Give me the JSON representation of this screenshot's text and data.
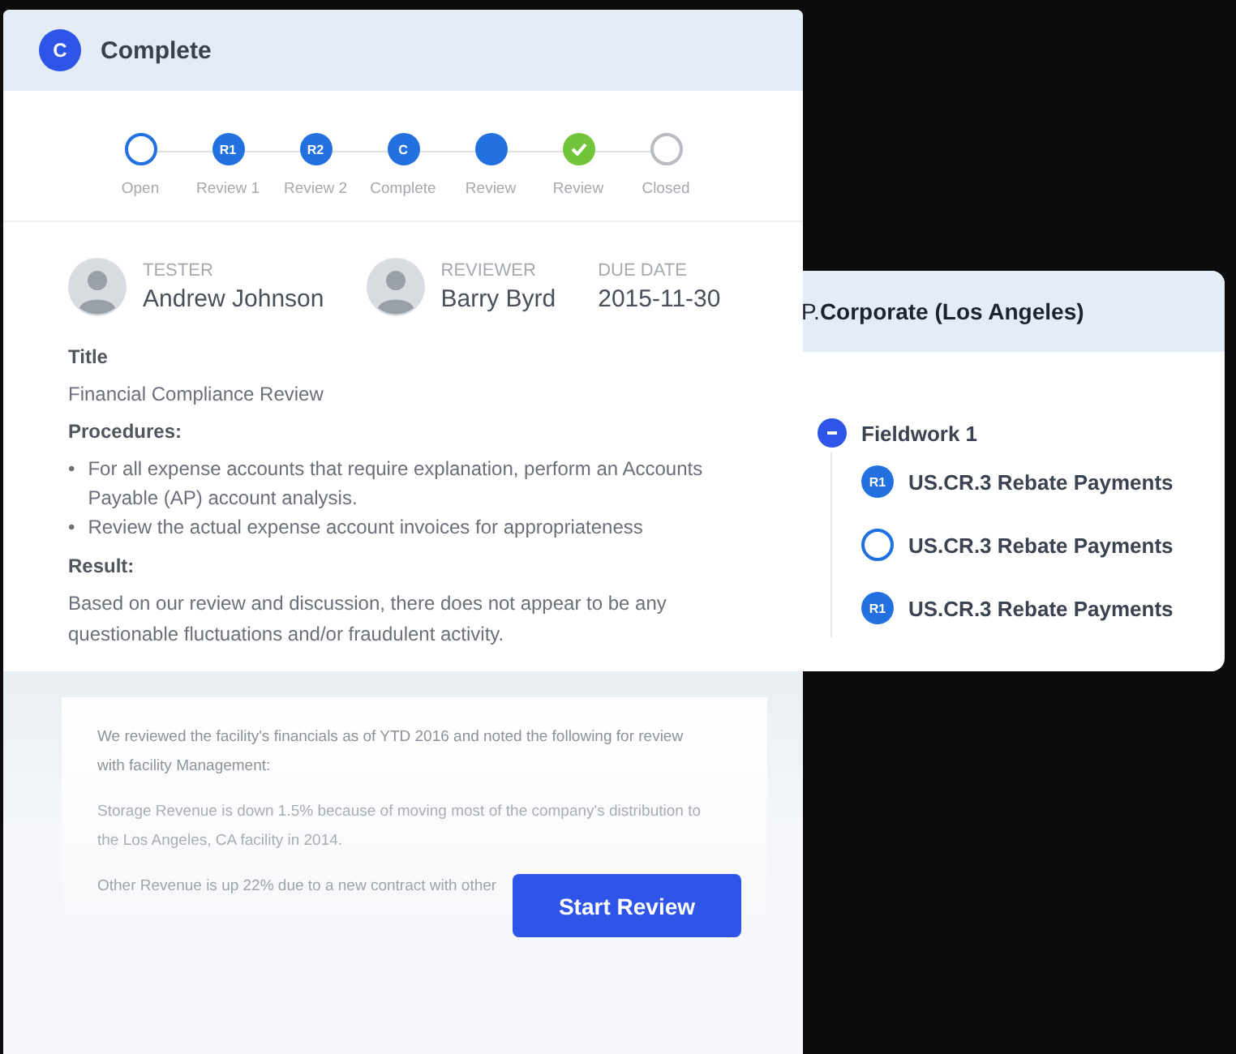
{
  "side_panel": {
    "title": "P.**Corporate (Los Angeles)**",
    "tree": [
      {
        "label": "Fieldwork 1",
        "expanded": true,
        "children": [
          {
            "label": "US.CR.3 Rebate Payments",
            "kind": "badge",
            "badge": "R1"
          },
          {
            "label": "US.CR.3 Rebate Payments",
            "kind": "open"
          },
          {
            "label": "US.CR.3 Rebate Payments",
            "kind": "badge",
            "badge": "R1"
          }
        ]
      }
    ]
  },
  "main_card": {
    "status_badge": "C",
    "title": "Complete",
    "steps": [
      {
        "label": "Open",
        "kind": "open"
      },
      {
        "label": "Review 1",
        "kind": "badge",
        "badge": "R1"
      },
      {
        "label": "Review 2",
        "kind": "badge",
        "badge": "R2"
      },
      {
        "label": "Complete",
        "kind": "badge",
        "badge": "C"
      },
      {
        "label": "Review",
        "kind": "filled"
      },
      {
        "label": "Review",
        "kind": "done"
      },
      {
        "label": "Closed",
        "kind": "closed"
      }
    ],
    "people": [
      {
        "role": "TESTER",
        "name": "Andrew Johnson",
        "kind": "avatar"
      },
      {
        "role": "REVIEWER",
        "name": "Barry Byrd",
        "kind": "avatar"
      },
      {
        "role": "DUE DATE",
        "name": "2015-11-30",
        "kind": "plain"
      }
    ],
    "title_label": "Title",
    "title_value": "Financial Compliance Review",
    "procedures_label": "Procedures:",
    "procedures": [
      {
        "marker": "•",
        "text": "For all expense accounts that require explanation, perform an Accounts Payable (AP) account analysis."
      },
      {
        "marker": "•",
        "text": "Review the actual expense account invoices for appropriateness"
      }
    ],
    "result_label": "Result:",
    "result": "Based on our review and discussion, there does not appear to be any questionable fluctuations and/or fraudulent activity.",
    "document": [
      "We reviewed the facility's financials as of YTD 2016 and noted the following for review with facility Management:",
      "Storage Revenue is down 1.5% because of moving most of the company's distribution to the Los Angeles, CA facility in 2014.",
      "Other Revenue is up 22% due to a new contract with other"
    ],
    "button": "Start Review"
  }
}
